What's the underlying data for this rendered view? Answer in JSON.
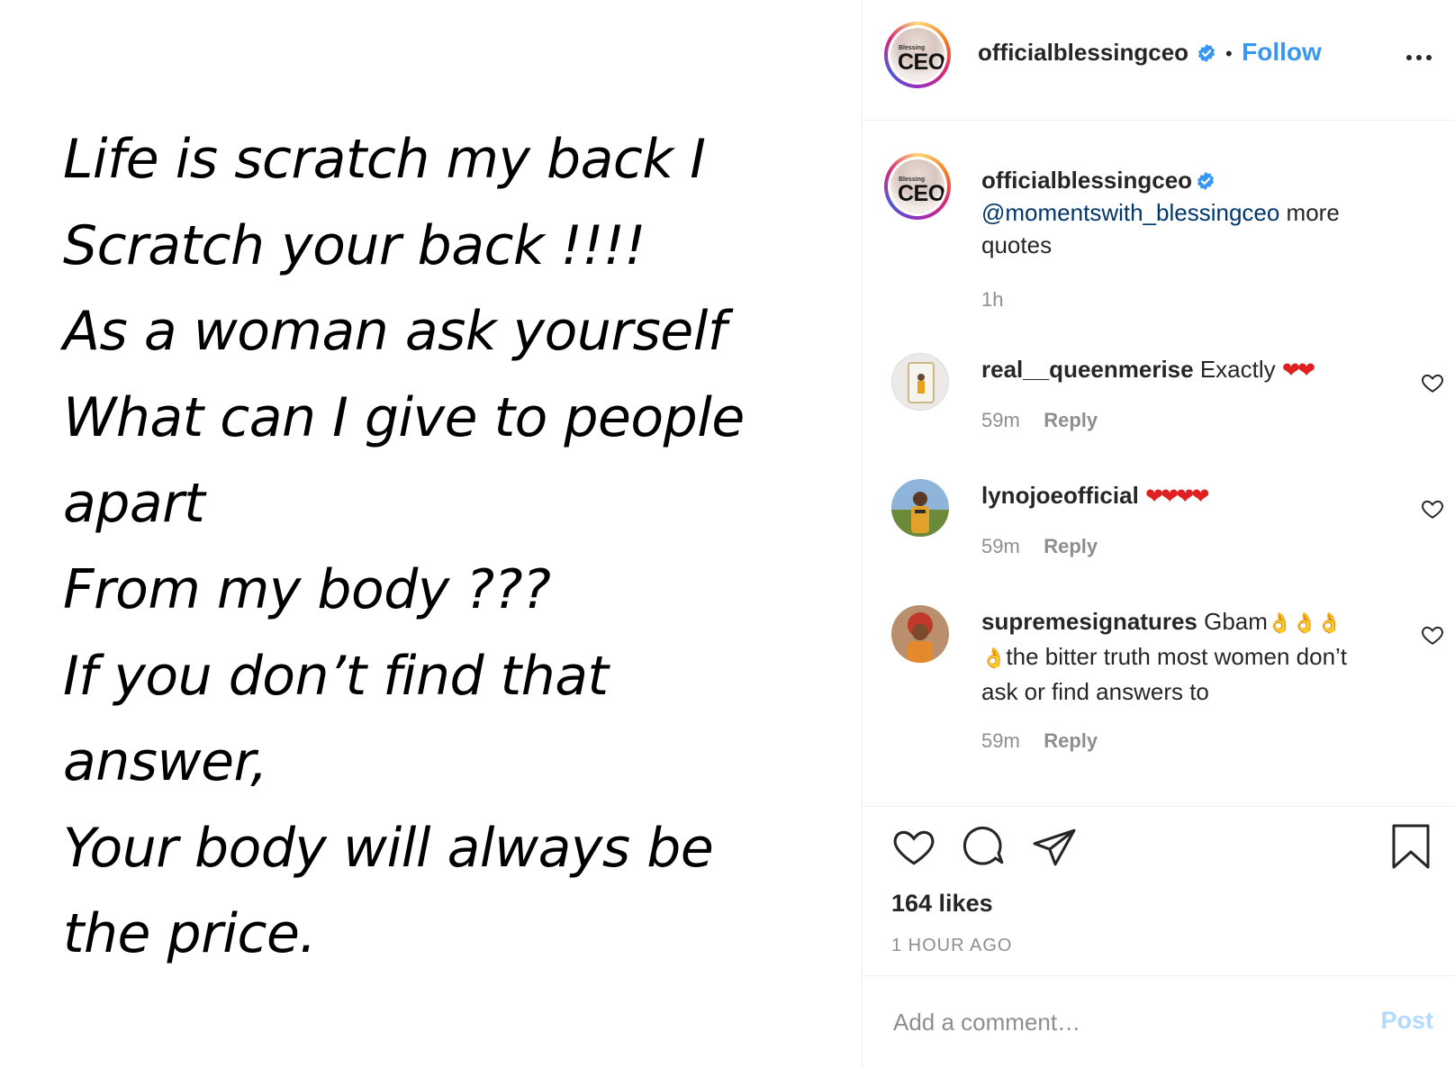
{
  "quote": {
    "lines": [
      "Life is scratch my back I",
      "Scratch your back !!!!",
      "As a woman ask yourself",
      "What can I give to people",
      "apart",
      "From my body ???",
      "If you don’t find that",
      "answer,",
      "Your body will always be",
      "the price."
    ]
  },
  "header": {
    "username": "officialblessingceo",
    "separator": "•",
    "follow_label": "Follow",
    "avatar_logo_small": "Blessing",
    "avatar_logo_big": "CEO",
    "icons": {
      "verified": "verified-badge-icon",
      "more": "more-options-icon"
    }
  },
  "caption": {
    "username": "officialblessingceo",
    "mention": "@momentswith_blessingceo",
    "text": " more quotes",
    "time": "1h"
  },
  "comments": [
    {
      "username": "real__queenmerise",
      "text": "Exactly ",
      "emoji": "❤❤",
      "time": "59m",
      "reply_label": "Reply"
    },
    {
      "username": "lynojoeofficial",
      "text": "",
      "emoji": "❤❤❤❤",
      "time": "59m",
      "reply_label": "Reply"
    },
    {
      "username": "supremesignatures",
      "text": "Gbam",
      "emoji": "👌👌👌",
      "text2_emoji": "👌",
      "text2": "the bitter truth most women don’t ask or find answers to",
      "time": "59m",
      "reply_label": "Reply"
    }
  ],
  "actions": {
    "likes": "164 likes",
    "ago": "1 HOUR AGO",
    "icons": [
      "heart-icon",
      "comment-icon",
      "share-icon",
      "bookmark-icon"
    ]
  },
  "comment_box": {
    "placeholder": "Add a comment…",
    "post_label": "Post"
  },
  "colors": {
    "link": "#3897f0",
    "mention": "#00376b",
    "muted": "#8e8e8e",
    "post_disabled": "#b3dbff",
    "verified": "#3897f0"
  }
}
